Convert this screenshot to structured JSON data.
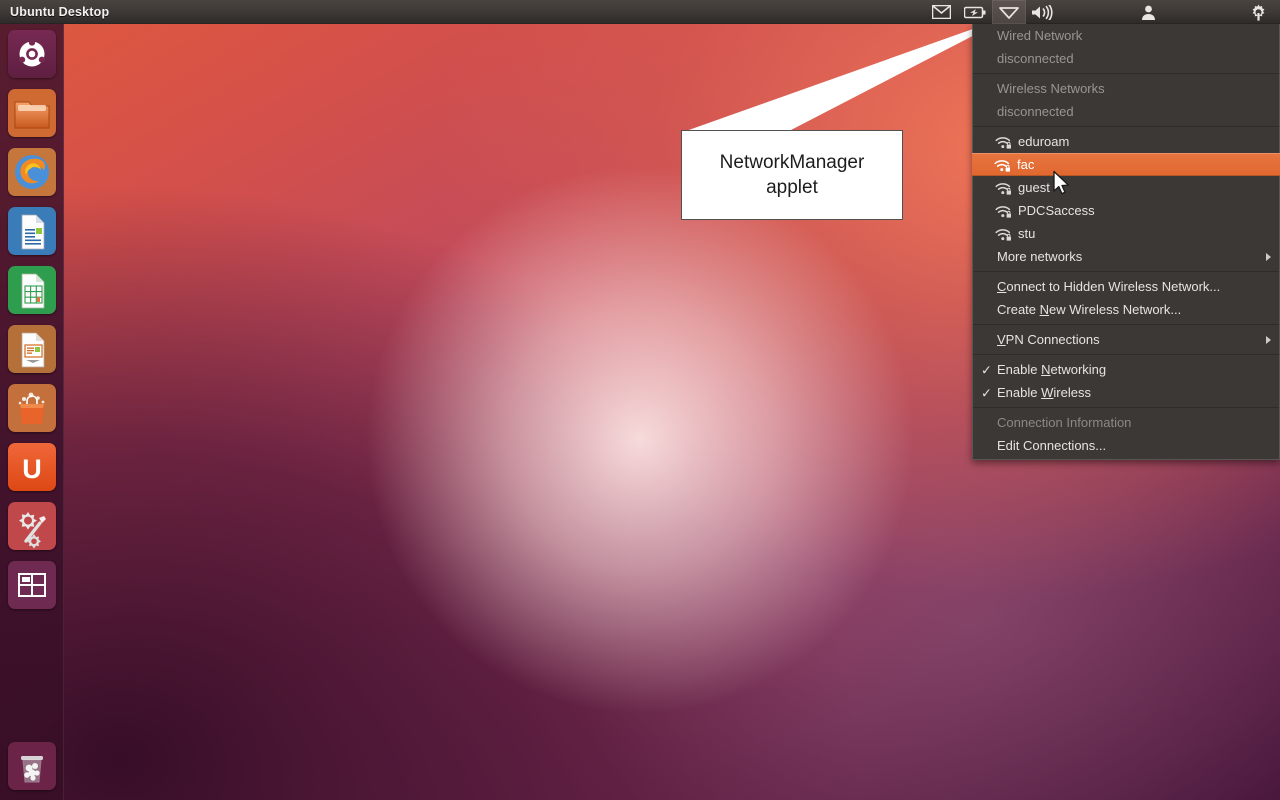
{
  "panel": {
    "title": "Ubuntu Desktop",
    "indicators": [
      {
        "name": "messaging-icon",
        "label": "Messaging menu",
        "active": false
      },
      {
        "name": "battery-icon",
        "label": "Battery",
        "active": false
      },
      {
        "name": "network-wifi-icon",
        "label": "NetworkManager applet",
        "active": true
      },
      {
        "name": "volume-icon",
        "label": "Sound",
        "active": false
      },
      {
        "name": "user-account-icon",
        "label": "User account menu",
        "active": false
      },
      {
        "name": "gear-icon",
        "label": "System settings menu",
        "active": false
      }
    ]
  },
  "launcher": {
    "items": [
      {
        "name": "dash-home",
        "label": "Dash home"
      },
      {
        "name": "files",
        "label": "Home Folder"
      },
      {
        "name": "firefox",
        "label": "Firefox Web Browser"
      },
      {
        "name": "libreoffice-writer",
        "label": "LibreOffice Writer"
      },
      {
        "name": "libreoffice-calc",
        "label": "LibreOffice Calc"
      },
      {
        "name": "libreoffice-impress",
        "label": "LibreOffice Impress"
      },
      {
        "name": "software-center",
        "label": "Ubuntu Software Center"
      },
      {
        "name": "ubuntu-one",
        "label": "Ubuntu One"
      },
      {
        "name": "system-settings",
        "label": "System Settings"
      },
      {
        "name": "workspace-switcher",
        "label": "Workspace Switcher"
      }
    ],
    "trash": {
      "name": "trash",
      "label": "Rubbish Bin"
    }
  },
  "callout": {
    "text": "NetworkManager\napplet"
  },
  "menu": {
    "wired": {
      "title": "Wired Network",
      "status": "disconnected"
    },
    "wireless": {
      "title": "Wireless Networks",
      "status": "disconnected"
    },
    "networks": [
      {
        "ssid": "eduroam",
        "secured": true,
        "selected": false
      },
      {
        "ssid": "fac",
        "secured": true,
        "selected": true
      },
      {
        "ssid": "guest",
        "secured": true,
        "selected": false
      },
      {
        "ssid": "PDCSaccess",
        "secured": true,
        "selected": false
      },
      {
        "ssid": "stu",
        "secured": true,
        "selected": false
      }
    ],
    "more_networks": "More networks",
    "connect_hidden": "Connect to Hidden Wireless Network...",
    "connect_hidden_mnemonic": "C",
    "create_new": "Create New Wireless Network...",
    "create_new_mnemonic": "N",
    "vpn_connections": "VPN Connections",
    "vpn_mnemonic": "V",
    "enable_networking": "Enable Networking",
    "enable_networking_mnemonic": "N",
    "enable_networking_checked": true,
    "enable_wireless": "Enable Wireless",
    "enable_wireless_mnemonic": "W",
    "enable_wireless_checked": true,
    "connection_information": "Connection Information",
    "connection_information_enabled": false,
    "edit_connections": "Edit Connections...",
    "highlight_color": "#e8743a"
  }
}
